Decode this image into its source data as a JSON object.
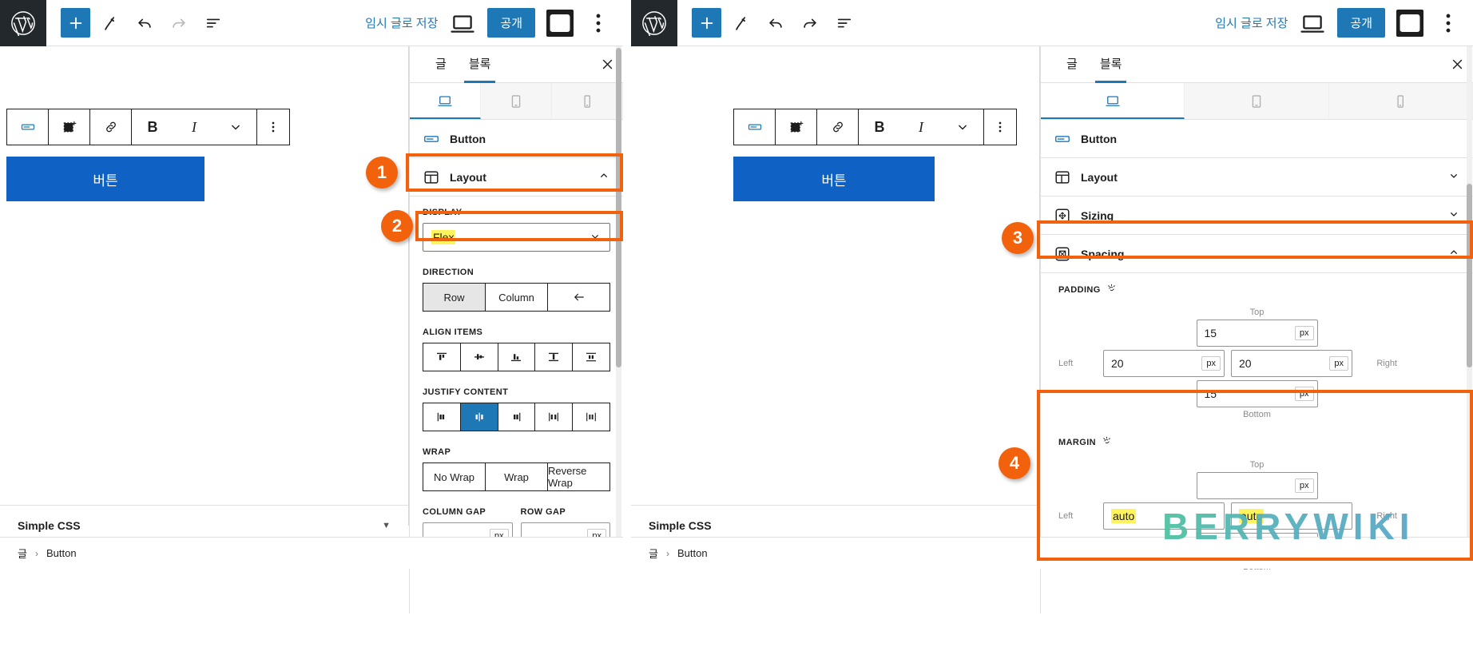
{
  "topbar": {
    "save_draft": "임시 글로 저장",
    "publish": "공개",
    "icons": {
      "wp_logo": "wordpress-logo-icon",
      "add_block": "plus-icon",
      "tools": "pencil-icon",
      "undo": "undo-icon",
      "redo": "redo-icon",
      "list_view": "list-view-icon",
      "preview": "desktop-preview-icon",
      "settings_sidebar": "settings-sidebar-icon",
      "options": "more-options-icon"
    }
  },
  "canvas": {
    "button_label": "버튼",
    "block_toolbar": {
      "block_type": "button-block-icon",
      "drag": "drag-handle-icon",
      "link": "link-icon",
      "bold": "B",
      "italic": "I",
      "more_formats": "chevron-down-icon",
      "options": "more-options-icon"
    }
  },
  "sidebar": {
    "tabs": [
      {
        "label": "글",
        "active": false
      },
      {
        "label": "블록",
        "active": true
      }
    ],
    "close_icon": "close-icon",
    "device_tabs": [
      {
        "name": "desktop-device-tab",
        "active": true
      },
      {
        "name": "tablet-device-tab",
        "active": false
      },
      {
        "name": "mobile-device-tab",
        "active": false
      }
    ],
    "block_title": "Button",
    "sections_left": [
      {
        "label": "Layout",
        "expanded": true,
        "icon": "layout-icon"
      }
    ],
    "sections_right": [
      {
        "label": "Layout",
        "expanded": false,
        "icon": "layout-icon"
      },
      {
        "label": "Sizing",
        "expanded": false,
        "icon": "sizing-icon"
      },
      {
        "label": "Spacing",
        "expanded": true,
        "icon": "spacing-icon"
      }
    ]
  },
  "layout_controls": {
    "display": {
      "label": "DISPLAY",
      "value": "Flex"
    },
    "direction": {
      "label": "DIRECTION",
      "options": [
        "Row",
        "Column"
      ],
      "selected": "Row",
      "extra_icon": "arrow-left-icon"
    },
    "align_items": {
      "label": "ALIGN ITEMS",
      "options": [
        "align-top",
        "align-center",
        "align-bottom",
        "stretch",
        "space-between"
      ],
      "selected": null
    },
    "justify_content": {
      "label": "JUSTIFY CONTENT",
      "options": [
        "justify-left",
        "justify-center",
        "justify-right",
        "space-between",
        "space-around"
      ],
      "selected": "justify-center"
    },
    "wrap": {
      "label": "WRAP",
      "options": [
        "No Wrap",
        "Wrap",
        "Reverse Wrap"
      ],
      "selected": null
    },
    "column_gap": {
      "label": "COLUMN GAP",
      "value": "",
      "unit": "px"
    },
    "row_gap": {
      "label": "ROW GAP",
      "value": "",
      "unit": "px"
    }
  },
  "spacing_controls": {
    "padding": {
      "label": "PADDING",
      "link_icon": "unlink-sides-icon",
      "top_label": "Top",
      "bottom_label": "Bottom",
      "left_label": "Left",
      "right_label": "Right",
      "top": "15",
      "right": "20",
      "bottom": "15",
      "left": "20",
      "unit": "px"
    },
    "margin": {
      "label": "MARGIN",
      "link_icon": "unlink-sides-icon",
      "top_label": "Top",
      "bottom_label": "Bottom",
      "left_label": "Left",
      "right_label": "Right",
      "top": "",
      "right": "auto",
      "bottom": "",
      "left": "auto",
      "unit": "px"
    }
  },
  "footer": {
    "simple_css": "Simple CSS",
    "caret": "▼",
    "breadcrumb": {
      "root": "글",
      "sep": "›",
      "current": "Button"
    }
  },
  "annotations": [
    {
      "num": "1",
      "target": "layout-section-left"
    },
    {
      "num": "2",
      "target": "display-select-left"
    },
    {
      "num": "3",
      "target": "spacing-section-right"
    },
    {
      "num": "4",
      "target": "margin-group-right"
    }
  ],
  "watermark": {
    "text": "BERRYWIKI"
  },
  "colors": {
    "accent_blue": "#1e78b5",
    "button_blue": "#0f62c4",
    "annotation_orange": "#f2610c",
    "highlight_yellow": "#fff45c",
    "admin_dark": "#23282d"
  }
}
